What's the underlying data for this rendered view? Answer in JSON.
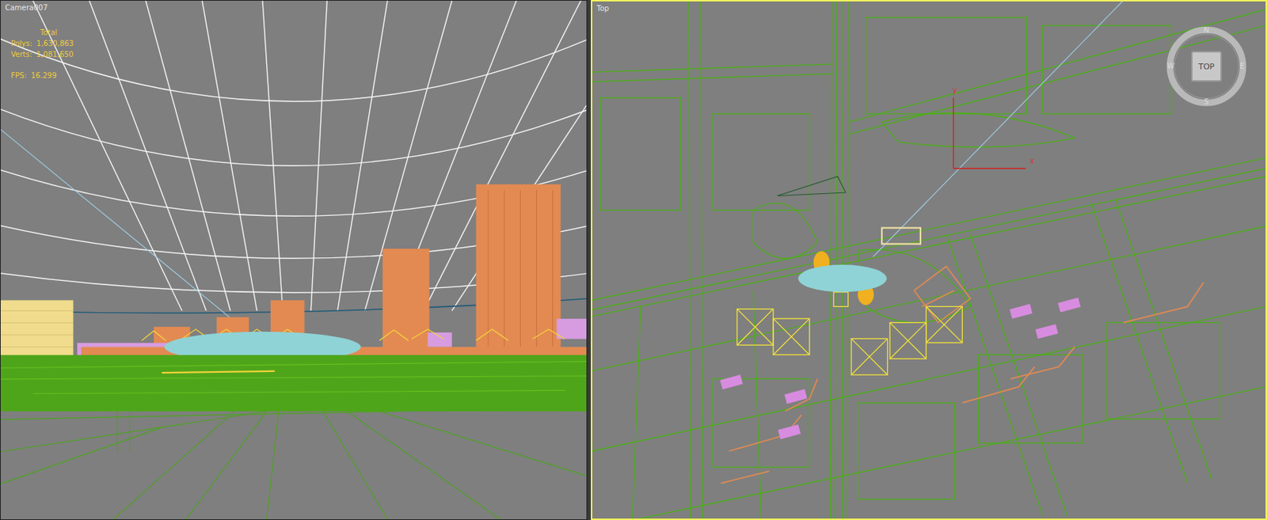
{
  "viewports": [
    {
      "label": "Camera007",
      "active": false,
      "stats": {
        "heading": "Total",
        "rows": [
          {
            "label": "Polys:",
            "value": "1,630,863"
          },
          {
            "label": "Verts:",
            "value": "1,081,650"
          },
          {
            "label": "FPS:",
            "value": "16.299"
          }
        ]
      }
    },
    {
      "label": "Top",
      "active": true,
      "viewcube": {
        "face": "TOP",
        "compass": [
          "N",
          "W",
          "E",
          "S"
        ]
      },
      "axes": [
        "y",
        "x"
      ]
    }
  ]
}
